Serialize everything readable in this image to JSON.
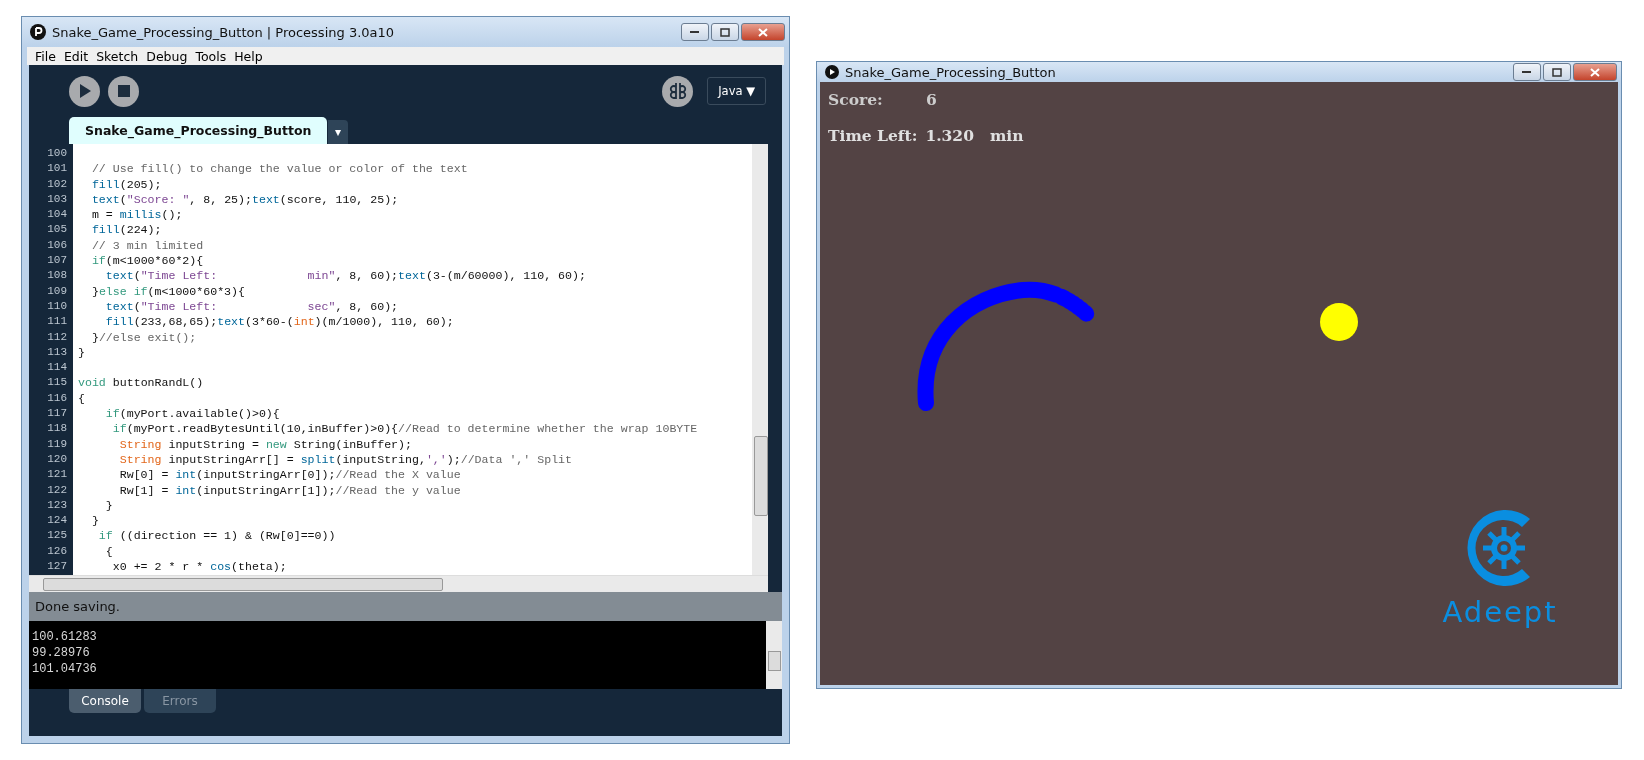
{
  "ide_window": {
    "title": "Snake_Game_Processing_Button | Processing 3.0a10",
    "menu": [
      "File",
      "Edit",
      "Sketch",
      "Debug",
      "Tools",
      "Help"
    ],
    "mode": "Java ▼",
    "tabs": [
      {
        "label": "Snake_Game_Processing_Button",
        "selected": true
      }
    ],
    "tab_menu": "▾",
    "code_lines": [
      {
        "number": "100"
      },
      {
        "number": "101",
        "tokens": [
          {
            "kind": "comment",
            "text": "  // Use fill() to change the value or color of the text"
          }
        ]
      },
      {
        "number": "102",
        "tokens": [
          {
            "kind": "func",
            "text": "  fill"
          },
          {
            "kind": "plain",
            "text": "(205);"
          }
        ]
      },
      {
        "number": "103",
        "tokens": [
          {
            "kind": "func",
            "text": "  text"
          },
          {
            "kind": "plain",
            "text": "("
          },
          {
            "kind": "string",
            "text": "\"Score: \""
          },
          {
            "kind": "plain",
            "text": ", 8, 25);"
          },
          {
            "kind": "func",
            "text": "text"
          },
          {
            "kind": "plain",
            "text": "(score, 110, 25);"
          }
        ]
      },
      {
        "number": "104",
        "tokens": [
          {
            "kind": "plain",
            "text": "  m = "
          },
          {
            "kind": "func",
            "text": "millis"
          },
          {
            "kind": "plain",
            "text": "();"
          }
        ]
      },
      {
        "number": "105",
        "tokens": [
          {
            "kind": "func",
            "text": "  fill"
          },
          {
            "kind": "plain",
            "text": "(224);"
          }
        ]
      },
      {
        "number": "106",
        "tokens": [
          {
            "kind": "comment",
            "text": "  // 3 min limited"
          }
        ]
      },
      {
        "number": "107",
        "tokens": [
          {
            "kind": "keyword",
            "text": "  if"
          },
          {
            "kind": "plain",
            "text": "(m<1000*60*2){"
          }
        ]
      },
      {
        "number": "108",
        "tokens": [
          {
            "kind": "func",
            "text": "    text"
          },
          {
            "kind": "plain",
            "text": "("
          },
          {
            "kind": "string",
            "text": "\"Time Left:             min\""
          },
          {
            "kind": "plain",
            "text": ", 8, 60);"
          },
          {
            "kind": "func",
            "text": "text"
          },
          {
            "kind": "plain",
            "text": "(3-(m/60000), 110, 60);"
          }
        ]
      },
      {
        "number": "109",
        "tokens": [
          {
            "kind": "plain",
            "text": "  }"
          },
          {
            "kind": "keyword",
            "text": "else if"
          },
          {
            "kind": "plain",
            "text": "(m<1000*60*3){"
          }
        ]
      },
      {
        "number": "110",
        "tokens": [
          {
            "kind": "func",
            "text": "    text"
          },
          {
            "kind": "plain",
            "text": "("
          },
          {
            "kind": "string",
            "text": "\"Time Left:             sec\""
          },
          {
            "kind": "plain",
            "text": ", 8, 60);"
          }
        ]
      },
      {
        "number": "111",
        "tokens": [
          {
            "kind": "func",
            "text": "    fill"
          },
          {
            "kind": "plain",
            "text": "(233,68,65);"
          },
          {
            "kind": "func",
            "text": "text"
          },
          {
            "kind": "plain",
            "text": "(3*60-("
          },
          {
            "kind": "type",
            "text": "int"
          },
          {
            "kind": "plain",
            "text": ")(m/1000), 110, 60);"
          }
        ]
      },
      {
        "number": "112",
        "tokens": [
          {
            "kind": "plain",
            "text": "  }"
          },
          {
            "kind": "comment",
            "text": "//else exit();"
          }
        ]
      },
      {
        "number": "113",
        "tokens": [
          {
            "kind": "plain",
            "text": "}"
          }
        ]
      },
      {
        "number": "114"
      },
      {
        "number": "115",
        "tokens": [
          {
            "kind": "keyword",
            "text": "void"
          },
          {
            "kind": "plain",
            "text": " buttonRandL()"
          }
        ]
      },
      {
        "number": "116",
        "tokens": [
          {
            "kind": "plain",
            "text": "{"
          }
        ]
      },
      {
        "number": "117",
        "tokens": [
          {
            "kind": "keyword",
            "text": "    if"
          },
          {
            "kind": "plain",
            "text": "(myPort.available()>0){"
          }
        ]
      },
      {
        "number": "118",
        "tokens": [
          {
            "kind": "keyword",
            "text": "     if"
          },
          {
            "kind": "plain",
            "text": "(myPort.readBytesUntil(10,inBuffer)>0){"
          },
          {
            "kind": "comment",
            "text": "//Read to determine whether the wrap 10BYTE"
          }
        ]
      },
      {
        "number": "119",
        "tokens": [
          {
            "kind": "type",
            "text": "      String"
          },
          {
            "kind": "plain",
            "text": " inputString = "
          },
          {
            "kind": "keyword",
            "text": "new"
          },
          {
            "kind": "plain",
            "text": " String(inBuffer);"
          }
        ]
      },
      {
        "number": "120",
        "tokens": [
          {
            "kind": "type",
            "text": "      String"
          },
          {
            "kind": "plain",
            "text": " inputStringArr[] = "
          },
          {
            "kind": "func",
            "text": "split"
          },
          {
            "kind": "plain",
            "text": "(inputString,"
          },
          {
            "kind": "string",
            "text": "','"
          },
          {
            "kind": "plain",
            "text": ");"
          },
          {
            "kind": "comment",
            "text": "//Data ',' Split"
          }
        ]
      },
      {
        "number": "121",
        "tokens": [
          {
            "kind": "plain",
            "text": "      Rw[0] = "
          },
          {
            "kind": "func",
            "text": "int"
          },
          {
            "kind": "plain",
            "text": "(inputStringArr[0]);"
          },
          {
            "kind": "comment",
            "text": "//Read the X value"
          }
        ]
      },
      {
        "number": "122",
        "tokens": [
          {
            "kind": "plain",
            "text": "      Rw[1] = "
          },
          {
            "kind": "func",
            "text": "int"
          },
          {
            "kind": "plain",
            "text": "(inputStringArr[1]);"
          },
          {
            "kind": "comment",
            "text": "//Read the y value"
          }
        ]
      },
      {
        "number": "123",
        "tokens": [
          {
            "kind": "plain",
            "text": "    }"
          }
        ]
      },
      {
        "number": "124",
        "tokens": [
          {
            "kind": "plain",
            "text": "  }"
          }
        ]
      },
      {
        "number": "125",
        "tokens": [
          {
            "kind": "keyword",
            "text": "   if"
          },
          {
            "kind": "plain",
            "text": " ((direction == 1) & (Rw[0]==0))"
          }
        ]
      },
      {
        "number": "126",
        "tokens": [
          {
            "kind": "plain",
            "text": "    {"
          }
        ]
      },
      {
        "number": "127",
        "tokens": [
          {
            "kind": "plain",
            "text": "     x0 += 2 * r * "
          },
          {
            "kind": "func",
            "text": "cos"
          },
          {
            "kind": "plain",
            "text": "(theta);"
          }
        ]
      }
    ],
    "status": "Done saving.",
    "console": [
      "100.61283",
      "99.28976",
      "101.04736"
    ],
    "bottom_tabs": [
      {
        "label": "Console",
        "selected": true
      },
      {
        "label": "Errors",
        "selected": false
      }
    ]
  },
  "sketch_window": {
    "title": "Snake_Game_Processing_Button",
    "score_label": "Score:",
    "score": "6",
    "time_label": "Time Left:",
    "time": "1.320",
    "time_unit": "min",
    "logo_text": "Adeept"
  }
}
